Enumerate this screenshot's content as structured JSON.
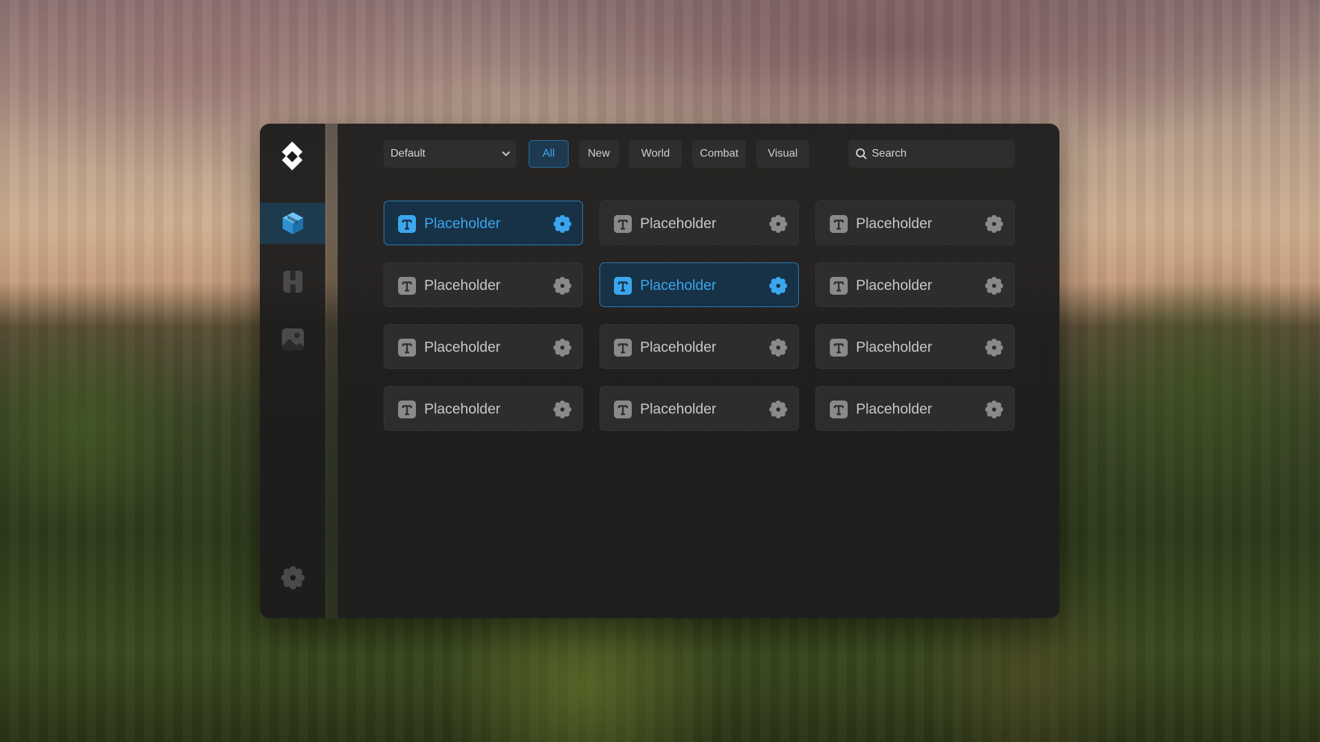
{
  "toolbar": {
    "dropdown_value": "Default",
    "tabs": [
      {
        "label": "All",
        "active": true
      },
      {
        "label": "New",
        "active": false
      },
      {
        "label": "World",
        "active": false
      },
      {
        "label": "Combat",
        "active": false
      },
      {
        "label": "Visual",
        "active": false
      }
    ],
    "search_placeholder": "Search"
  },
  "sidebar": {
    "items": [
      {
        "icon": "cube-icon",
        "active": true
      },
      {
        "icon": "shirt-icon",
        "active": false
      },
      {
        "icon": "image-icon",
        "active": false
      }
    ],
    "bottom_icon": "gear-icon"
  },
  "modules": [
    {
      "label": "Placeholder",
      "active": true
    },
    {
      "label": "Placeholder",
      "active": false
    },
    {
      "label": "Placeholder",
      "active": false
    },
    {
      "label": "Placeholder",
      "active": false
    },
    {
      "label": "Placeholder",
      "active": true
    },
    {
      "label": "Placeholder",
      "active": false
    },
    {
      "label": "Placeholder",
      "active": false
    },
    {
      "label": "Placeholder",
      "active": false
    },
    {
      "label": "Placeholder",
      "active": false
    },
    {
      "label": "Placeholder",
      "active": false
    },
    {
      "label": "Placeholder",
      "active": false
    },
    {
      "label": "Placeholder",
      "active": false
    }
  ],
  "colors": {
    "accent": "#3ba6ee",
    "panel": "#1e1e1e",
    "card": "#2d2d2d"
  }
}
